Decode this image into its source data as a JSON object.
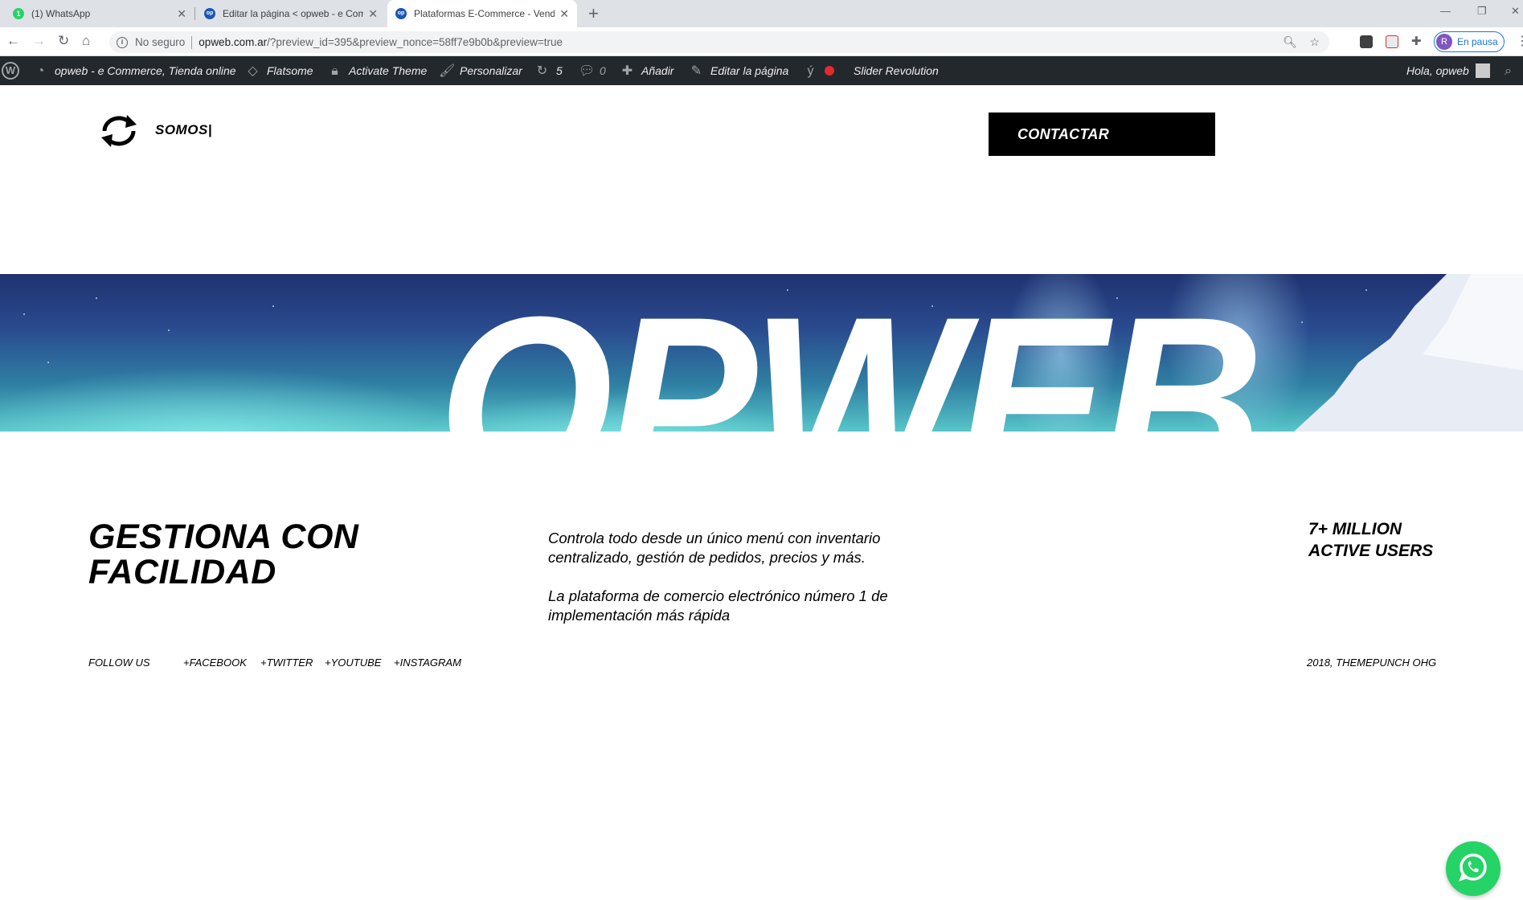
{
  "browser": {
    "tabs": [
      {
        "title": "(1) WhatsApp",
        "favicon": "whatsapp-icon",
        "badge": "1",
        "active": false
      },
      {
        "title": "Editar la página < opweb - e Com",
        "favicon": "opweb-icon",
        "active": false
      },
      {
        "title": "Plataformas E-Commerce - Vend",
        "favicon": "opweb-icon",
        "active": true
      }
    ],
    "security_label": "No seguro",
    "url_host": "opweb.com.ar",
    "url_path": "/?preview_id=395&preview_nonce=58ff7e9b0b&preview=true",
    "profile_initial": "R",
    "profile_status": "En pausa"
  },
  "adminbar": {
    "site_name": "opweb - e Commerce, Tienda online",
    "flatsome": "Flatsome",
    "activate_theme": "Activate Theme",
    "customize": "Personalizar",
    "updates_count": "5",
    "comments_count": "0",
    "new": "Añadir",
    "edit_page": "Editar la página",
    "slider": "Slider Revolution",
    "howdy": "Hola, opweb"
  },
  "page": {
    "nav_label": "SOMOS|",
    "cta_label": "CONTACTAR",
    "hero_text": "OPWEB",
    "headline_line1": "GESTIONA CON",
    "headline_line2": "FACILIDAD",
    "desc_p1": "Controla todo desde un único menú con inventario centralizado, gestión de pedidos, precios y más.",
    "desc_p2": "La plataforma de comercio electrónico número 1 de implementación más rápida",
    "stat_line1": "7+ MILLION",
    "stat_line2": "ACTIVE USERS",
    "follow_us": "FOLLOW US",
    "social_links": [
      "+FACEBOOK",
      "+TWITTER",
      "+YOUTUBE",
      "+INSTAGRAM"
    ],
    "copyright": "2018, THEMEPUNCH OHG"
  },
  "colors": {
    "adminbar_bg": "#23282d",
    "cta_bg": "#000000",
    "whatsapp_green": "#25d366",
    "profile_accent": "#1a73e8"
  }
}
